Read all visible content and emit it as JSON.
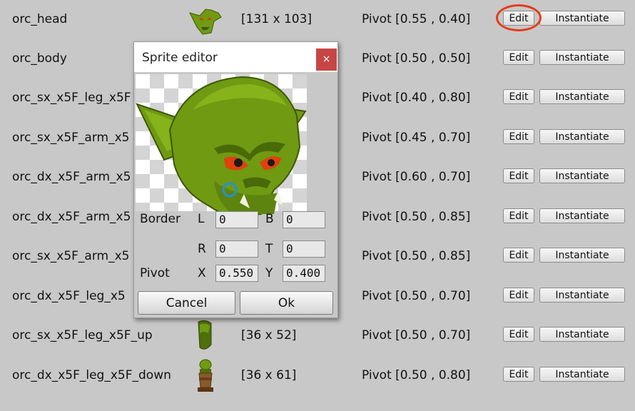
{
  "sprites": [
    {
      "name": "orc_head",
      "size": "[131 x 103]",
      "pivot": "Pivot [0.55 , 0.40]",
      "thumb": "orc-head-icon"
    },
    {
      "name": "orc_body",
      "size": "",
      "pivot": "Pivot [0.50 , 0.50]",
      "thumb": ""
    },
    {
      "name": "orc_sx_x5F_leg_x5F",
      "size": "",
      "pivot": "Pivot [0.40 , 0.80]",
      "thumb": ""
    },
    {
      "name": "orc_sx_x5F_arm_x5",
      "size": "",
      "pivot": "Pivot [0.45 , 0.70]",
      "thumb": ""
    },
    {
      "name": "orc_dx_x5F_arm_x5",
      "size": "",
      "pivot": "Pivot [0.60 , 0.70]",
      "thumb": ""
    },
    {
      "name": "orc_dx_x5F_arm_x5",
      "size": "",
      "pivot": "Pivot [0.50 , 0.85]",
      "thumb": ""
    },
    {
      "name": "orc_sx_x5F_arm_x5",
      "size": "",
      "pivot": "Pivot [0.50 , 0.85]",
      "thumb": ""
    },
    {
      "name": "orc_dx_x5F_leg_x5",
      "size": "",
      "pivot": "Pivot [0.50 , 0.70]",
      "thumb": ""
    },
    {
      "name": "orc_sx_x5F_leg_x5F_up",
      "size": "[36 x 52]",
      "pivot": "Pivot [0.50 , 0.70]",
      "thumb": "orc-leg-up-icon"
    },
    {
      "name": "orc_dx_x5F_leg_x5F_down",
      "size": "[36 x 61]",
      "pivot": "Pivot [0.50 , 0.80]",
      "thumb": "orc-leg-down-icon"
    }
  ],
  "buttons": {
    "edit": "Edit",
    "instantiate": "Instantiate"
  },
  "dialog": {
    "title": "Sprite editor",
    "close": "×",
    "border_label": "Border",
    "pivot_label": "Pivot",
    "L_label": "L",
    "B_label": "B",
    "R_label": "R",
    "T_label": "T",
    "X_label": "X",
    "Y_label": "Y",
    "L": "0",
    "B": "0",
    "R": "0",
    "T": "0",
    "X": "0.550",
    "Y": "0.400",
    "cancel": "Cancel",
    "ok": "Ok"
  },
  "colors": {
    "background": "#c8c8c8",
    "highlight": "#e53a1a",
    "close_button": "#c74545",
    "orc_green": "#6f9a12"
  }
}
